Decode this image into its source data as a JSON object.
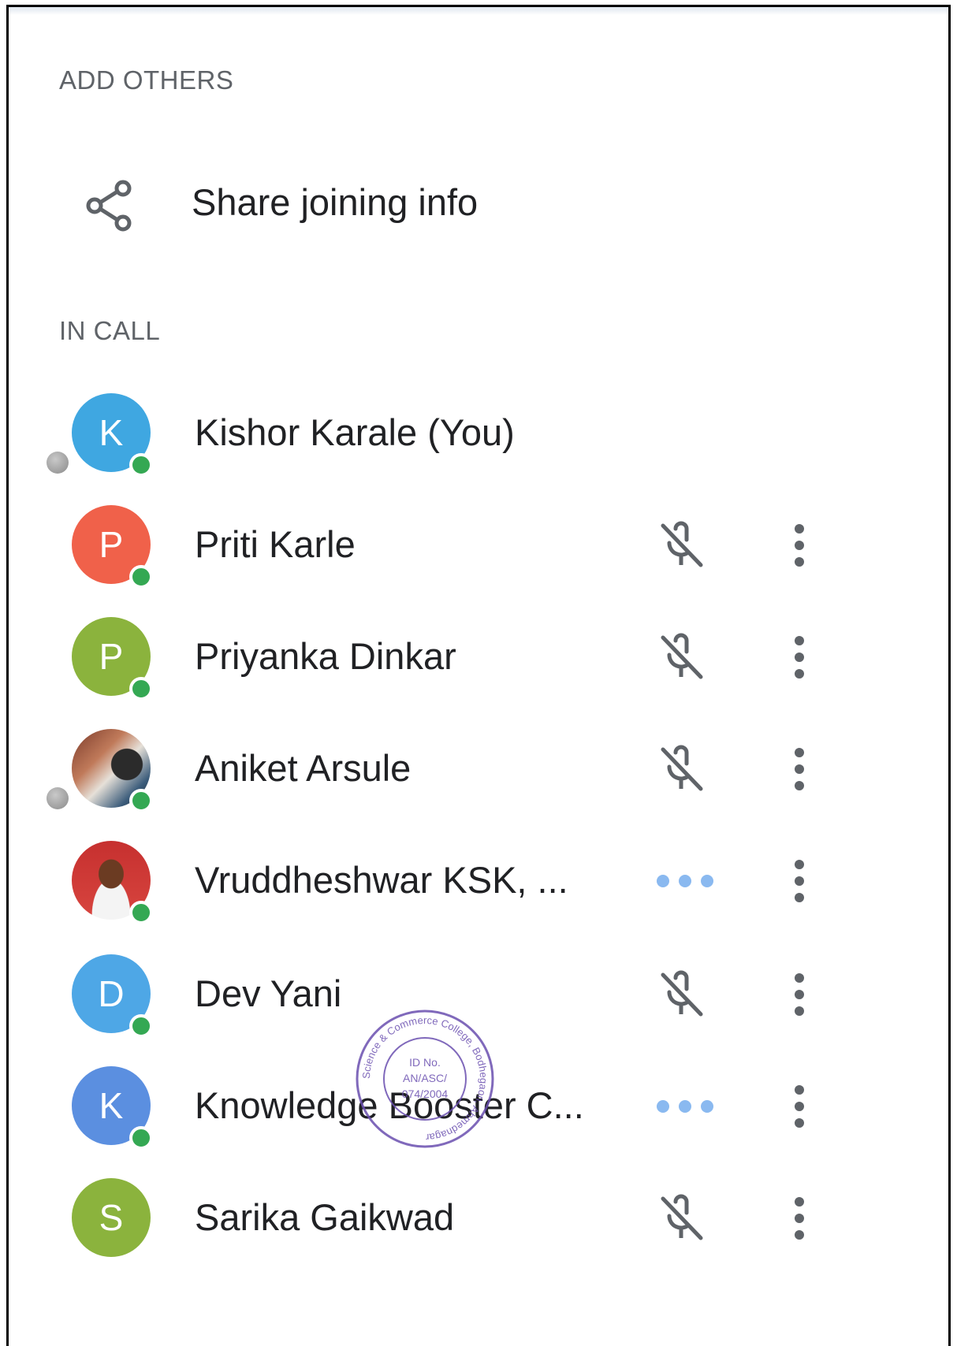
{
  "sections": {
    "add_others": "ADD OTHERS",
    "in_call": "IN CALL"
  },
  "share": {
    "label": "Share joining info",
    "icon": "share-icon"
  },
  "participants": [
    {
      "name": "Kishor Karale (You)",
      "initial": "K",
      "avatar_color": "#3fa7e1",
      "status": "none"
    },
    {
      "name": "Priti Karle",
      "initial": "P",
      "avatar_color": "#f0614a",
      "status": "muted"
    },
    {
      "name": "Priyanka Dinkar",
      "initial": "P",
      "avatar_color": "#8bb33d",
      "status": "muted"
    },
    {
      "name": "Aniket Arsule",
      "initial": "",
      "avatar_color": "photo",
      "status": "muted"
    },
    {
      "name": "Vruddheshwar KSK, ...",
      "initial": "",
      "avatar_color": "photo",
      "status": "talking"
    },
    {
      "name": "Dev Yani",
      "initial": "D",
      "avatar_color": "#4ea7e6",
      "status": "muted"
    },
    {
      "name": "Knowledge Booster C...",
      "initial": "K",
      "avatar_color": "#5b8fe0",
      "status": "talking"
    },
    {
      "name": "Sarika Gaikwad",
      "initial": "S",
      "avatar_color": "#8bb33d",
      "status": "muted"
    }
  ],
  "stamp": {
    "text_top": "Science & Commerce College, Bodhegaon, Ahmednagar",
    "text_center": [
      "ID No.",
      "AN/ASC/",
      "074/2004"
    ]
  },
  "colors": {
    "online": "#34a853",
    "icon_gray": "#5f6368",
    "talking_blue": "#8ab9f0",
    "label_gray": "#5f6368"
  }
}
